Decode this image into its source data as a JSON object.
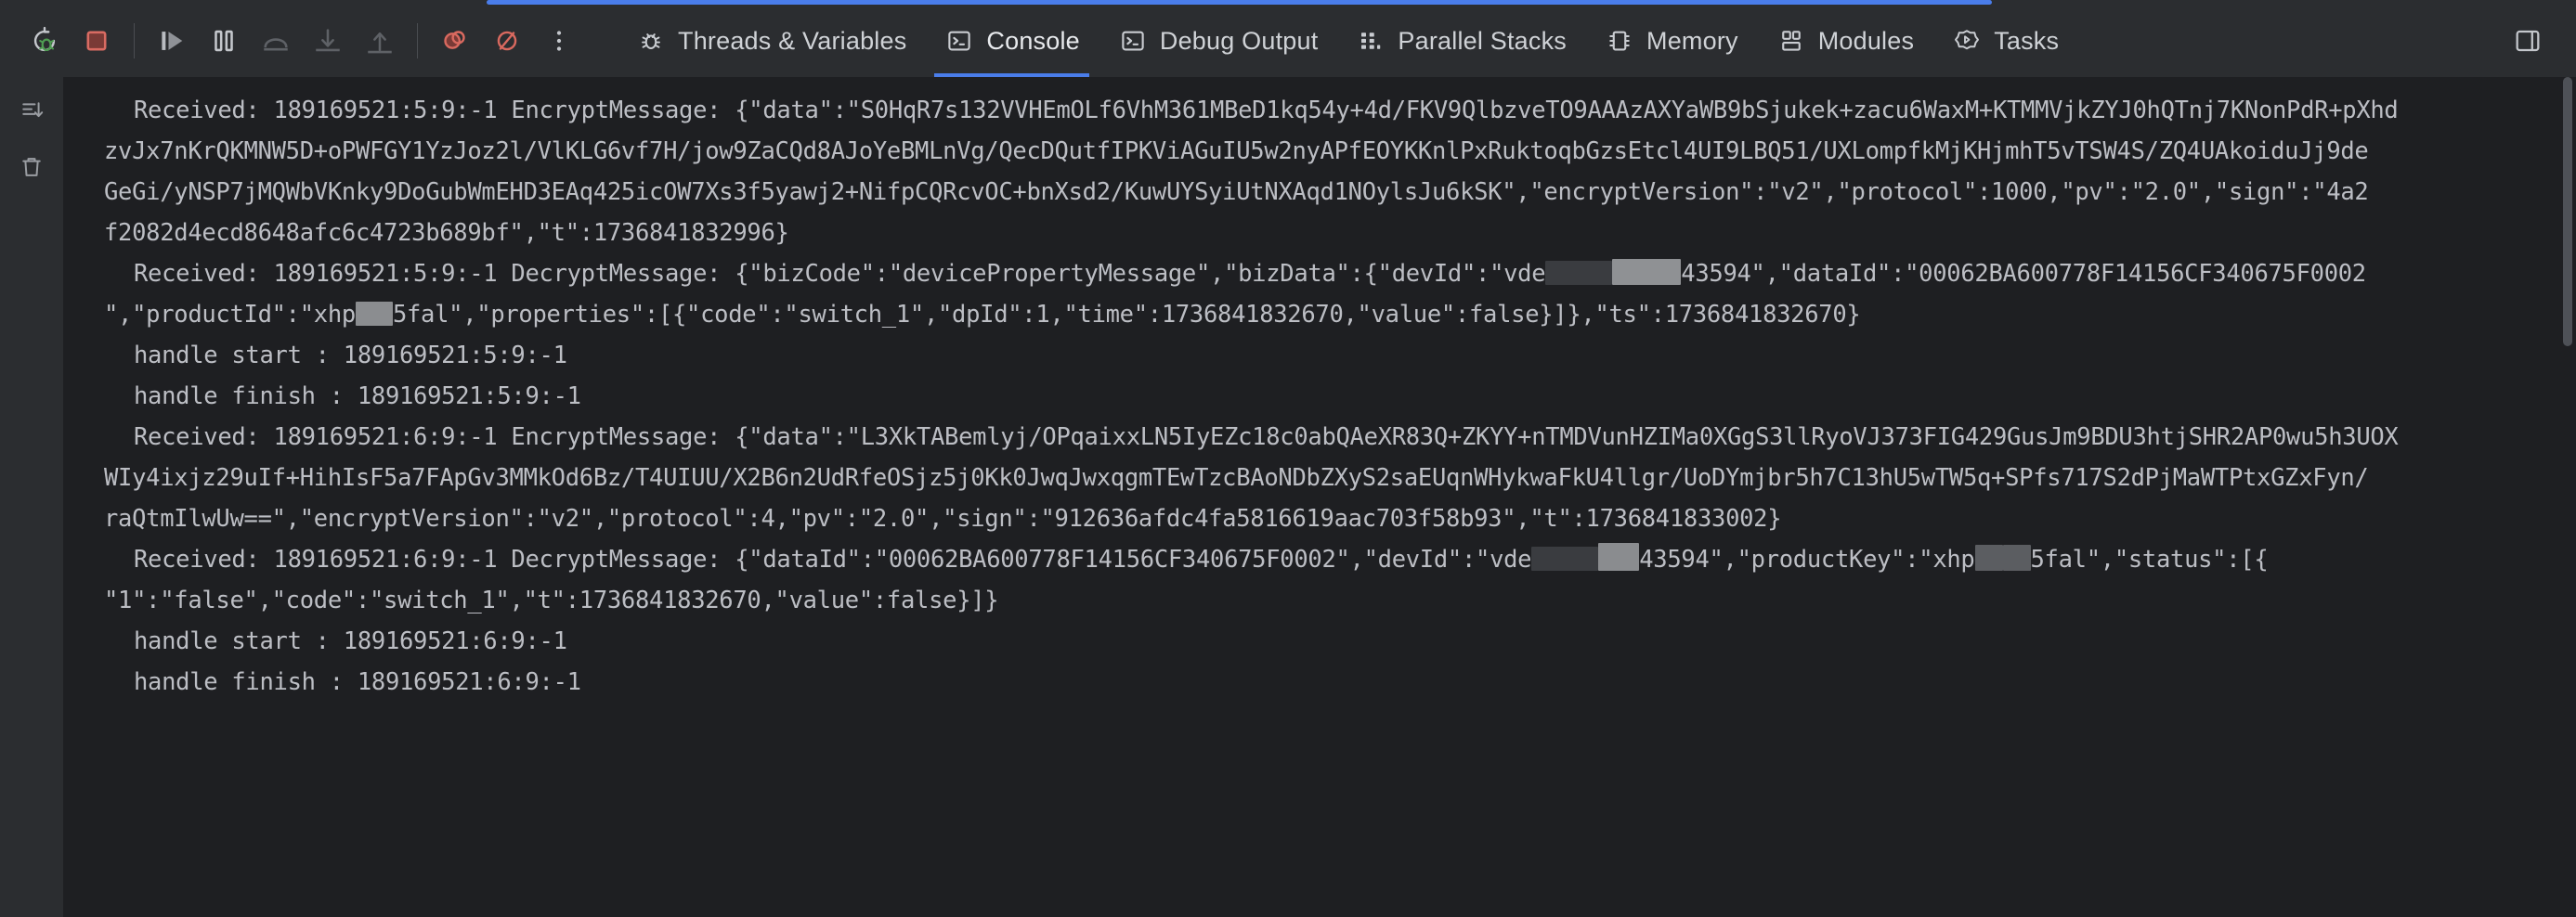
{
  "window": {
    "progress_accent": "#4a7dea",
    "background": "#2b2d30",
    "console_background": "#1e1f22"
  },
  "toolbar": {
    "buttons": [
      {
        "name": "rerun-debug-button",
        "icon": "rerun-bug-icon",
        "title": "Rerun"
      },
      {
        "name": "stop-button",
        "icon": "stop-square-icon",
        "title": "Stop"
      },
      {
        "name": "resume-button",
        "icon": "resume-program-icon",
        "title": "Resume Program"
      },
      {
        "name": "pause-button",
        "icon": "pause-program-icon",
        "title": "Pause Program"
      },
      {
        "name": "step-over-button",
        "icon": "step-over-icon",
        "title": "Step Over"
      },
      {
        "name": "step-into-button",
        "icon": "step-into-icon",
        "title": "Step Into"
      },
      {
        "name": "step-out-button",
        "icon": "step-out-icon",
        "title": "Step Out"
      },
      {
        "name": "view-breakpoints-button",
        "icon": "breakpoint-icon",
        "title": "View Breakpoints"
      },
      {
        "name": "mute-breakpoints-button",
        "icon": "mute-breakpoint-icon",
        "title": "Mute Breakpoints"
      },
      {
        "name": "more-options-button",
        "icon": "more-vertical-icon",
        "title": "More"
      }
    ],
    "right_buttons": [
      {
        "name": "layout-settings-button",
        "icon": "layout-panel-icon",
        "title": "Layout Settings"
      }
    ]
  },
  "tabs": [
    {
      "label": "Threads & Variables",
      "icon": "bug-icon",
      "active": false
    },
    {
      "label": "Console",
      "icon": "console-icon",
      "active": true
    },
    {
      "label": "Debug Output",
      "icon": "console-icon",
      "active": false
    },
    {
      "label": "Parallel Stacks",
      "icon": "parallel-stacks-icon",
      "active": false
    },
    {
      "label": "Memory",
      "icon": "memory-icon",
      "active": false
    },
    {
      "label": "Modules",
      "icon": "modules-icon",
      "active": false
    },
    {
      "label": "Tasks",
      "icon": "tasks-icon",
      "active": false
    }
  ],
  "gutter": {
    "buttons": [
      {
        "name": "scroll-to-end-button",
        "icon": "scroll-to-end-icon",
        "title": "Scroll to End"
      },
      {
        "name": "clear-all-button",
        "icon": "trash-icon",
        "title": "Clear All"
      }
    ]
  },
  "console": {
    "lines": [
      {
        "id": "l1",
        "indent": "first",
        "text": "Received: 189169521:5:9:-1 EncryptMessage: {\"data\":\"S0HqR7s132VVHEmOLf6VhM361MBeD1kq54y+4d/FKV9QlbzveTO9AAAzAXYaWB9bSjukek+zacu6WaxM+KTMMVjkZYJ0hQTnj7KNonPdR+pXhd"
      },
      {
        "id": "l2",
        "indent": "cont",
        "text": "zvJx7nKrQKMNW5D+oPWFGY1YzJoz2l/VlKLG6vf7H/jow9ZaCQd8AJoYeBMLnVg/QecDQutfIPKViAGuIU5w2nyAPfEOYKKnlPxRuktoqbGzsEtcl4UI9LBQ51/UXLompfkMjKHjmhT5vTSW4S/ZQ4UAkoiduJj9de"
      },
      {
        "id": "l3",
        "indent": "cont",
        "text": "GeGi/yNSP7jMQWbVKnky9DoGubWmEHD3EAq425icOW7Xs3f5yawj2+NifpCQRcvOC+bnXsd2/KuwUYSyiUtNXAqd1NOylsJu6kSK\",\"encryptVersion\":\"v2\",\"protocol\":1000,\"pv\":\"2.0\",\"sign\":\"4a2"
      },
      {
        "id": "l4",
        "indent": "cont",
        "text": "f2082d4ecd8648afc6c4723b689bf\",\"t\":1736841832996}"
      },
      {
        "id": "l5",
        "indent": "first",
        "redacted": true,
        "segments": [
          {
            "type": "text",
            "value": "Received: 189169521:5:9:-1 DecryptMessage: {\"bizCode\":\"devicePropertyMessage\",\"bizData\":{\"devId\":\"vde"
          },
          {
            "type": "redact",
            "style": "r1"
          },
          {
            "type": "redact",
            "style": "sp"
          },
          {
            "type": "redact",
            "style": "r2"
          },
          {
            "type": "text",
            "value": "43594\",\"dataId\":\"00062BA600778F14156CF340675F0002"
          }
        ]
      },
      {
        "id": "l6",
        "indent": "cont",
        "redacted": true,
        "segments": [
          {
            "type": "text",
            "value": "\",\"productId\":\"xhp"
          },
          {
            "type": "redact",
            "style": "r3"
          },
          {
            "type": "redact",
            "style": "sp"
          },
          {
            "type": "text",
            "value": "5fal\",\"properties\":[{\"code\":\"switch_1\",\"dpId\":1,\"time\":1736841832670,\"value\":false}]},\"ts\":1736841832670}"
          }
        ]
      },
      {
        "id": "l7",
        "indent": "first",
        "text": "handle start : 189169521:5:9:-1"
      },
      {
        "id": "l8",
        "indent": "first",
        "text": "handle finish : 189169521:5:9:-1"
      },
      {
        "id": "l9",
        "indent": "first",
        "text": "Received: 189169521:6:9:-1 EncryptMessage: {\"data\":\"L3XkTABemlyj/OPqaixxLN5IyEZc18c0abQAeXR83Q+ZKYY+nTMDVunHZIMa0XGgS3llRyoVJ373FIG429GusJm9BDU3htjSHR2AP0wu5h3UOX"
      },
      {
        "id": "l10",
        "indent": "cont",
        "text": "WIy4ixjz29uIf+HihIsF5a7FApGv3MMkOd6Bz/T4UIUU/X2B6n2UdRfeOSjz5j0Kk0JwqJwxqgmTEwTzcBAoNDbZXyS2saEUqnWHykwaFkU4llgr/UoDYmjbr5h7C13hU5wTW5q+SPfs717S2dPjMaWTPtxGZxFyn/"
      },
      {
        "id": "l11",
        "indent": "cont",
        "text": "raQtmIlwUw==\",\"encryptVersion\":\"v2\",\"protocol\":4,\"pv\":\"2.0\",\"sign\":\"912636afdc4fa5816619aac703f58b93\",\"t\":1736841833002}"
      },
      {
        "id": "l12",
        "indent": "first",
        "redacted": true,
        "segments": [
          {
            "type": "text",
            "value": "Received: 189169521:6:9:-1 DecryptMessage: {\"dataId\":\"00062BA600778F14156CF340675F0002\",\"devId\":\"vde"
          },
          {
            "type": "redact",
            "style": "r1"
          },
          {
            "type": "redact",
            "style": "sp"
          },
          {
            "type": "redact",
            "style": "r4"
          },
          {
            "type": "text",
            "value": "43594\",\"productKey\":\"xhp"
          },
          {
            "type": "redact",
            "style": "r5"
          },
          {
            "type": "redact",
            "style": "sp"
          },
          {
            "type": "redact",
            "style": "r5"
          },
          {
            "type": "text",
            "value": "5fal\",\"status\":[{"
          }
        ]
      },
      {
        "id": "l13",
        "indent": "cont",
        "text": "\"1\":\"false\",\"code\":\"switch_1\",\"t\":1736841832670,\"value\":false}]}"
      },
      {
        "id": "l14",
        "indent": "first",
        "text": "handle start : 189169521:6:9:-1"
      },
      {
        "id": "l15",
        "indent": "first",
        "text": "handle finish : 189169521:6:9:-1"
      }
    ]
  },
  "scrollbar": {
    "name": "vertical-scrollbar",
    "thumb_top": 0,
    "thumb_height": 290
  }
}
